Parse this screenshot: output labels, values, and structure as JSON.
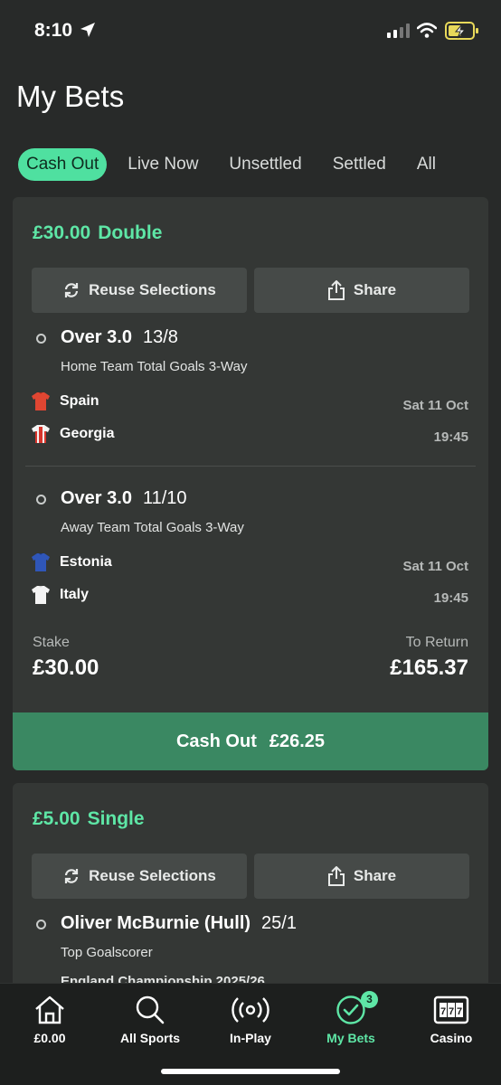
{
  "status_bar": {
    "time": "8:10"
  },
  "page_title": "My Bets",
  "tabs": [
    "Cash Out",
    "Live Now",
    "Unsettled",
    "Settled",
    "All"
  ],
  "bets": [
    {
      "stake_amount": "£30.00",
      "bet_type": "Double",
      "reuse_label": "Reuse Selections",
      "share_label": "Share",
      "selections": [
        {
          "title": "Over 3.0",
          "odds": "13/8",
          "market": "Home Team Total Goals 3-Way",
          "teams": [
            "Spain",
            "Georgia"
          ],
          "date": "Sat 11 Oct",
          "time": "19:45"
        },
        {
          "title": "Over 3.0",
          "odds": "11/10",
          "market": "Away Team Total Goals 3-Way",
          "teams": [
            "Estonia",
            "Italy"
          ],
          "date": "Sat 11 Oct",
          "time": "19:45"
        }
      ],
      "stake_label": "Stake",
      "stake_value": "£30.00",
      "return_label": "To Return",
      "return_value": "£165.37",
      "cashout_label": "Cash Out",
      "cashout_value": "£26.25"
    },
    {
      "stake_amount": "£5.00",
      "bet_type": "Single",
      "reuse_label": "Reuse Selections",
      "share_label": "Share",
      "selection": {
        "title": "Oliver McBurnie (Hull)",
        "odds": "25/1",
        "market": "Top Goalscorer",
        "competition": "England Championship 2025/26"
      }
    }
  ],
  "bottom_nav": [
    {
      "label": "£0.00",
      "icon": "home-icon"
    },
    {
      "label": "All Sports",
      "icon": "search-icon"
    },
    {
      "label": "In-Play",
      "icon": "broadcast-icon"
    },
    {
      "label": "My Bets",
      "icon": "checkmark-circle-icon",
      "badge": "3"
    },
    {
      "label": "Casino",
      "icon": "slot-machine-icon"
    }
  ],
  "colors": {
    "accent": "#5ee6a6",
    "cashout_button": "#3a8862",
    "card": "#343735",
    "background": "#282a29"
  }
}
